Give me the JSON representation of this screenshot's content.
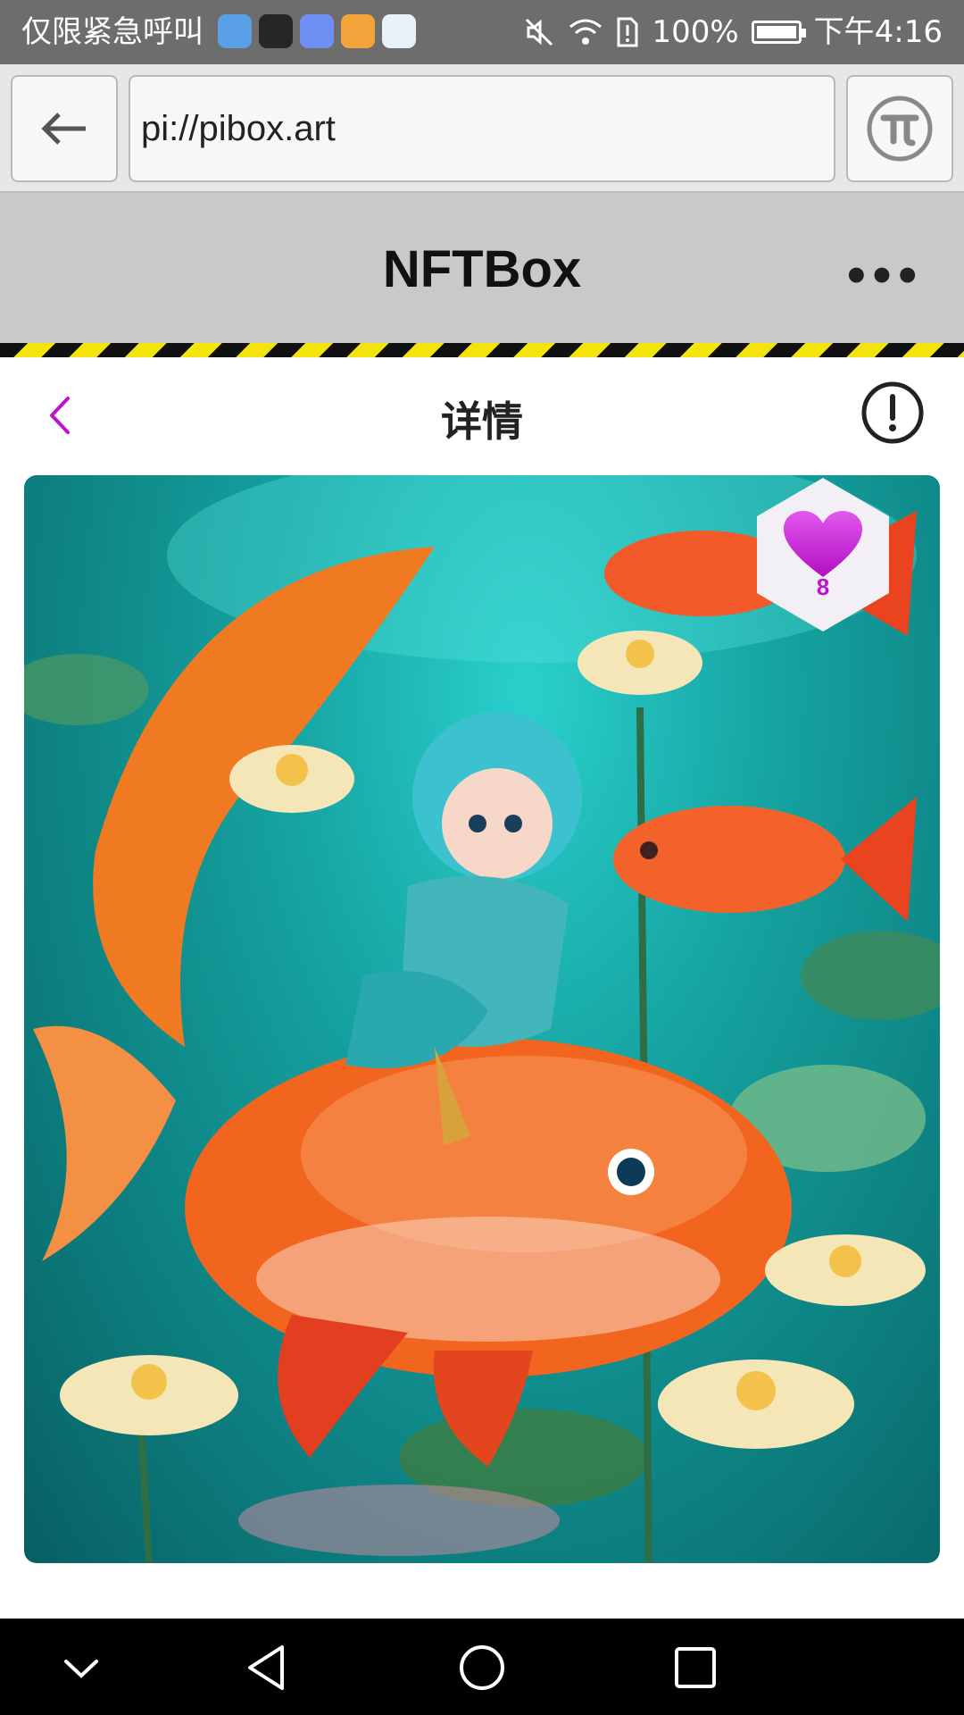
{
  "status_bar": {
    "carrier_text": "仅限紧急呼叫",
    "battery_text": "100%",
    "time": "下午4:16",
    "apps": [
      "browser-app-icon",
      "huawei-app-icon",
      "music-app-icon",
      "files-app-icon",
      "camera-app-icon"
    ]
  },
  "browser": {
    "url": "pi://pibox.art",
    "back_icon": "arrow-left-icon",
    "pi_icon": "pi-coin-icon"
  },
  "app": {
    "title": "NFTBox",
    "more_label": "•••"
  },
  "detail": {
    "title": "详情",
    "back_icon": "chevron-left-icon",
    "info_icon": "exclamation-circle-icon",
    "like_count": "8",
    "like_icon": "heart-icon"
  },
  "colors": {
    "accent": "#c012cc",
    "hazard_dark": "#111111",
    "hazard_yellow": "#f2e40c",
    "header_bg": "#c9c9c9",
    "statusbar_bg": "#6d6d6d"
  },
  "navbar": {
    "icons": [
      "chevron-down-icon",
      "back-triangle-icon",
      "home-circle-icon",
      "recents-square-icon"
    ]
  }
}
